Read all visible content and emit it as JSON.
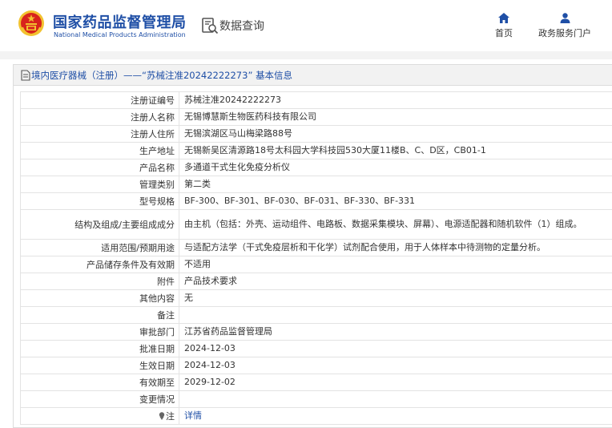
{
  "header": {
    "site_name": "国家药品监督管理局",
    "site_name_en": "National Medical Products Administration",
    "query_label": "数据查询",
    "nav": {
      "home_label": "首页",
      "portal_label": "政务服务门户"
    }
  },
  "title": {
    "category": "境内医疗器械（注册）",
    "separator": "——",
    "registration_number": "“苏械注准20242222273”",
    "suffix": "基本信息"
  },
  "rows": [
    {
      "label": "注册证编号",
      "value": "苏械注准20242222273"
    },
    {
      "label": "注册人名称",
      "value": "无锡博慧斯生物医药科技有限公司"
    },
    {
      "label": "注册人住所",
      "value": "无锡滨湖区马山梅梁路88号"
    },
    {
      "label": "生产地址",
      "value": "无锡新吴区清源路18号太科园大学科技园530大厦11楼B、C、D区，CB01-1"
    },
    {
      "label": "产品名称",
      "value": "多通道干式生化免疫分析仪"
    },
    {
      "label": "管理类别",
      "value": "第二类"
    },
    {
      "label": "型号规格",
      "value": "BF-300、BF-301、BF-030、BF-031、BF-330、BF-331"
    },
    {
      "label": "结构及组成/主要组成成分",
      "value": "由主机（包括：外壳、运动组件、电路板、数据采集模块、屏幕）、电源适配器和随机软件（1）组成。"
    },
    {
      "label": "适用范围/预期用途",
      "value": "与适配方法学（干式免疫层析和干化学）试剂配合使用，用于人体样本中待测物的定量分析。"
    },
    {
      "label": "产品储存条件及有效期",
      "value": "不适用"
    },
    {
      "label": "附件",
      "value": "产品技术要求"
    },
    {
      "label": "其他内容",
      "value": "无"
    },
    {
      "label": "备注",
      "value": ""
    },
    {
      "label": "审批部门",
      "value": "江苏省药品监督管理局"
    },
    {
      "label": "批准日期",
      "value": "2024-12-03"
    },
    {
      "label": "生效日期",
      "value": "2024-12-03"
    },
    {
      "label": "有效期至",
      "value": "2029-12-02"
    },
    {
      "label": "变更情况",
      "value": ""
    }
  ],
  "note_row": {
    "label": "注",
    "link": "详情"
  },
  "colors": {
    "brand_blue": "#1f4fa6",
    "emblem_red": "#d8231c",
    "emblem_gold": "#f2c230"
  },
  "icons": [
    "national-emblem-icon",
    "search-document-icon",
    "home-icon",
    "user-icon",
    "document-icon",
    "pin-icon"
  ]
}
